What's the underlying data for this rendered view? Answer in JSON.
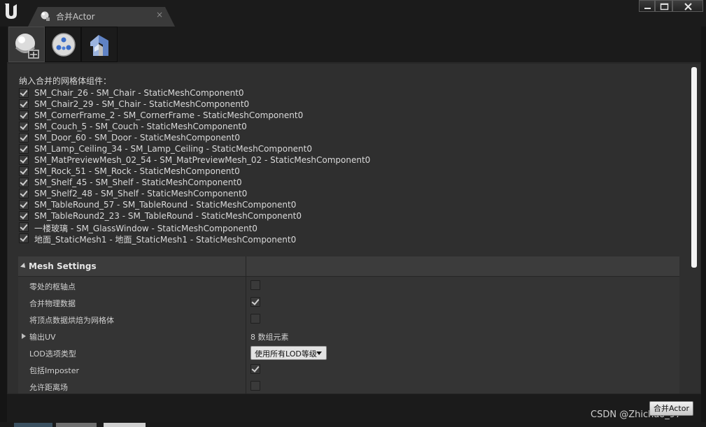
{
  "window": {
    "tab_title": "合并Actor",
    "tab_close": "×",
    "colors": {
      "background": "#151515",
      "panel": "#2f2f2f",
      "header": "#3c3c3c",
      "accent": "#e3e3e3"
    }
  },
  "toolbar": {
    "modes": [
      {
        "icon": "merge-actors-icon",
        "active": true
      },
      {
        "icon": "harvest-geometry-icon",
        "active": false
      },
      {
        "icon": "proxy-geometry-icon",
        "active": false
      }
    ]
  },
  "components": {
    "label": "纳入合并的网格体组件：",
    "items": [
      {
        "label": "SM_Chair_26 - SM_Chair - StaticMeshComponent0",
        "checked": true
      },
      {
        "label": "SM_Chair2_29 - SM_Chair - StaticMeshComponent0",
        "checked": true
      },
      {
        "label": "SM_CornerFrame_2 - SM_CornerFrame - StaticMeshComponent0",
        "checked": true
      },
      {
        "label": "SM_Couch_5 - SM_Couch - StaticMeshComponent0",
        "checked": true
      },
      {
        "label": "SM_Door_60 - SM_Door - StaticMeshComponent0",
        "checked": true
      },
      {
        "label": "SM_Lamp_Ceiling_34 - SM_Lamp_Ceiling - StaticMeshComponent0",
        "checked": true
      },
      {
        "label": "SM_MatPreviewMesh_02_54 - SM_MatPreviewMesh_02 - StaticMeshComponent0",
        "checked": true
      },
      {
        "label": "SM_Rock_51 - SM_Rock - StaticMeshComponent0",
        "checked": true
      },
      {
        "label": "SM_Shelf_45 - SM_Shelf - StaticMeshComponent0",
        "checked": true
      },
      {
        "label": "SM_Shelf2_48 - SM_Shelf - StaticMeshComponent0",
        "checked": true
      },
      {
        "label": "SM_TableRound_57 - SM_TableRound - StaticMeshComponent0",
        "checked": true
      },
      {
        "label": "SM_TableRound2_23 - SM_TableRound - StaticMeshComponent0",
        "checked": true
      },
      {
        "label": "一楼玻璃 - SM_GlassWindow - StaticMeshComponent0",
        "checked": true
      },
      {
        "label": "地面_StaticMesh1 - 地面_StaticMesh1 - StaticMeshComponent0",
        "checked": true
      }
    ]
  },
  "mesh_settings": {
    "title": "Mesh Settings",
    "rows": [
      {
        "name": "零处的枢轴点",
        "type": "checkbox",
        "checked": false
      },
      {
        "name": "合并物理数据",
        "type": "checkbox",
        "checked": true
      },
      {
        "name": "将顶点数据烘焙为网格体",
        "type": "checkbox",
        "checked": false
      },
      {
        "name": "输出UV",
        "type": "text",
        "value": "8 数组元素",
        "expandable": true
      },
      {
        "name": "LOD选项类型",
        "type": "dropdown",
        "value": "使用所有LOD等级"
      },
      {
        "name": "包括Imposter",
        "type": "checkbox",
        "checked": true
      },
      {
        "name": "允许距离场",
        "type": "checkbox",
        "checked": false
      }
    ]
  },
  "footer": {
    "merge_button": "合并Actor",
    "watermark": "CSDN @Zhichao_97"
  }
}
